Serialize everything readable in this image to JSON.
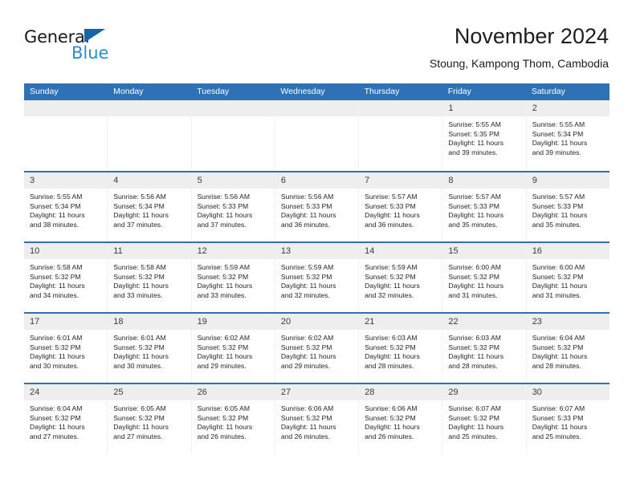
{
  "brand": {
    "word_one": "General",
    "word_two": "Blue",
    "triangle_color": "#1565a8",
    "blue_text_color": "#2e8bd4",
    "logo_icon": "triangle-icon"
  },
  "header": {
    "title": "November 2024",
    "subtitle": "Stoung, Kampong Thom, Cambodia"
  },
  "theme": {
    "header_blue": "#2e72b5",
    "day_band_gray": "#eeeeee",
    "text_color": "#252525"
  },
  "weekdays": [
    "Sunday",
    "Monday",
    "Tuesday",
    "Wednesday",
    "Thursday",
    "Friday",
    "Saturday"
  ],
  "weeks": [
    [
      {
        "blank": true
      },
      {
        "blank": true
      },
      {
        "blank": true
      },
      {
        "blank": true
      },
      {
        "blank": true
      },
      {
        "day": "1",
        "sunrise": "Sunrise: 5:55 AM",
        "sunset": "Sunset: 5:35 PM",
        "daylight_1": "Daylight: 11 hours",
        "daylight_2": "and 39 minutes."
      },
      {
        "day": "2",
        "sunrise": "Sunrise: 5:55 AM",
        "sunset": "Sunset: 5:34 PM",
        "daylight_1": "Daylight: 11 hours",
        "daylight_2": "and 39 minutes."
      }
    ],
    [
      {
        "day": "3",
        "sunrise": "Sunrise: 5:55 AM",
        "sunset": "Sunset: 5:34 PM",
        "daylight_1": "Daylight: 11 hours",
        "daylight_2": "and 38 minutes."
      },
      {
        "day": "4",
        "sunrise": "Sunrise: 5:56 AM",
        "sunset": "Sunset: 5:34 PM",
        "daylight_1": "Daylight: 11 hours",
        "daylight_2": "and 37 minutes."
      },
      {
        "day": "5",
        "sunrise": "Sunrise: 5:56 AM",
        "sunset": "Sunset: 5:33 PM",
        "daylight_1": "Daylight: 11 hours",
        "daylight_2": "and 37 minutes."
      },
      {
        "day": "6",
        "sunrise": "Sunrise: 5:56 AM",
        "sunset": "Sunset: 5:33 PM",
        "daylight_1": "Daylight: 11 hours",
        "daylight_2": "and 36 minutes."
      },
      {
        "day": "7",
        "sunrise": "Sunrise: 5:57 AM",
        "sunset": "Sunset: 5:33 PM",
        "daylight_1": "Daylight: 11 hours",
        "daylight_2": "and 36 minutes."
      },
      {
        "day": "8",
        "sunrise": "Sunrise: 5:57 AM",
        "sunset": "Sunset: 5:33 PM",
        "daylight_1": "Daylight: 11 hours",
        "daylight_2": "and 35 minutes."
      },
      {
        "day": "9",
        "sunrise": "Sunrise: 5:57 AM",
        "sunset": "Sunset: 5:33 PM",
        "daylight_1": "Daylight: 11 hours",
        "daylight_2": "and 35 minutes."
      }
    ],
    [
      {
        "day": "10",
        "sunrise": "Sunrise: 5:58 AM",
        "sunset": "Sunset: 5:32 PM",
        "daylight_1": "Daylight: 11 hours",
        "daylight_2": "and 34 minutes."
      },
      {
        "day": "11",
        "sunrise": "Sunrise: 5:58 AM",
        "sunset": "Sunset: 5:32 PM",
        "daylight_1": "Daylight: 11 hours",
        "daylight_2": "and 33 minutes."
      },
      {
        "day": "12",
        "sunrise": "Sunrise: 5:59 AM",
        "sunset": "Sunset: 5:32 PM",
        "daylight_1": "Daylight: 11 hours",
        "daylight_2": "and 33 minutes."
      },
      {
        "day": "13",
        "sunrise": "Sunrise: 5:59 AM",
        "sunset": "Sunset: 5:32 PM",
        "daylight_1": "Daylight: 11 hours",
        "daylight_2": "and 32 minutes."
      },
      {
        "day": "14",
        "sunrise": "Sunrise: 5:59 AM",
        "sunset": "Sunset: 5:32 PM",
        "daylight_1": "Daylight: 11 hours",
        "daylight_2": "and 32 minutes."
      },
      {
        "day": "15",
        "sunrise": "Sunrise: 6:00 AM",
        "sunset": "Sunset: 5:32 PM",
        "daylight_1": "Daylight: 11 hours",
        "daylight_2": "and 31 minutes."
      },
      {
        "day": "16",
        "sunrise": "Sunrise: 6:00 AM",
        "sunset": "Sunset: 5:32 PM",
        "daylight_1": "Daylight: 11 hours",
        "daylight_2": "and 31 minutes."
      }
    ],
    [
      {
        "day": "17",
        "sunrise": "Sunrise: 6:01 AM",
        "sunset": "Sunset: 5:32 PM",
        "daylight_1": "Daylight: 11 hours",
        "daylight_2": "and 30 minutes."
      },
      {
        "day": "18",
        "sunrise": "Sunrise: 6:01 AM",
        "sunset": "Sunset: 5:32 PM",
        "daylight_1": "Daylight: 11 hours",
        "daylight_2": "and 30 minutes."
      },
      {
        "day": "19",
        "sunrise": "Sunrise: 6:02 AM",
        "sunset": "Sunset: 5:32 PM",
        "daylight_1": "Daylight: 11 hours",
        "daylight_2": "and 29 minutes."
      },
      {
        "day": "20",
        "sunrise": "Sunrise: 6:02 AM",
        "sunset": "Sunset: 5:32 PM",
        "daylight_1": "Daylight: 11 hours",
        "daylight_2": "and 29 minutes."
      },
      {
        "day": "21",
        "sunrise": "Sunrise: 6:03 AM",
        "sunset": "Sunset: 5:32 PM",
        "daylight_1": "Daylight: 11 hours",
        "daylight_2": "and 28 minutes."
      },
      {
        "day": "22",
        "sunrise": "Sunrise: 6:03 AM",
        "sunset": "Sunset: 5:32 PM",
        "daylight_1": "Daylight: 11 hours",
        "daylight_2": "and 28 minutes."
      },
      {
        "day": "23",
        "sunrise": "Sunrise: 6:04 AM",
        "sunset": "Sunset: 5:32 PM",
        "daylight_1": "Daylight: 11 hours",
        "daylight_2": "and 28 minutes."
      }
    ],
    [
      {
        "day": "24",
        "sunrise": "Sunrise: 6:04 AM",
        "sunset": "Sunset: 5:32 PM",
        "daylight_1": "Daylight: 11 hours",
        "daylight_2": "and 27 minutes."
      },
      {
        "day": "25",
        "sunrise": "Sunrise: 6:05 AM",
        "sunset": "Sunset: 5:32 PM",
        "daylight_1": "Daylight: 11 hours",
        "daylight_2": "and 27 minutes."
      },
      {
        "day": "26",
        "sunrise": "Sunrise: 6:05 AM",
        "sunset": "Sunset: 5:32 PM",
        "daylight_1": "Daylight: 11 hours",
        "daylight_2": "and 26 minutes."
      },
      {
        "day": "27",
        "sunrise": "Sunrise: 6:06 AM",
        "sunset": "Sunset: 5:32 PM",
        "daylight_1": "Daylight: 11 hours",
        "daylight_2": "and 26 minutes."
      },
      {
        "day": "28",
        "sunrise": "Sunrise: 6:06 AM",
        "sunset": "Sunset: 5:32 PM",
        "daylight_1": "Daylight: 11 hours",
        "daylight_2": "and 26 minutes."
      },
      {
        "day": "29",
        "sunrise": "Sunrise: 6:07 AM",
        "sunset": "Sunset: 5:32 PM",
        "daylight_1": "Daylight: 11 hours",
        "daylight_2": "and 25 minutes."
      },
      {
        "day": "30",
        "sunrise": "Sunrise: 6:07 AM",
        "sunset": "Sunset: 5:33 PM",
        "daylight_1": "Daylight: 11 hours",
        "daylight_2": "and 25 minutes."
      }
    ]
  ]
}
